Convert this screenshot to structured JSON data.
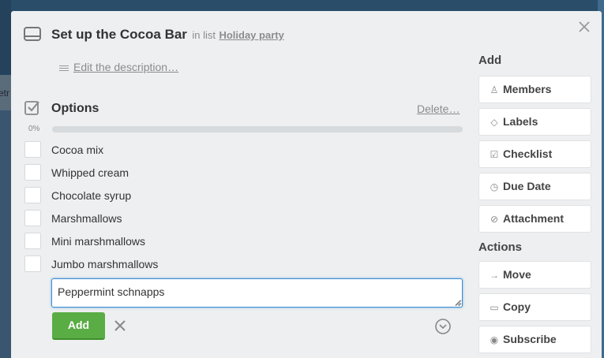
{
  "card": {
    "title": "Set up the Cocoa Bar",
    "in_list_prefix": "in list",
    "list_name": "Holiday party",
    "edit_description": "Edit the description…"
  },
  "checklist": {
    "title": "Options",
    "delete_label": "Delete…",
    "progress_label": "0%",
    "progress_percent": 0,
    "items": [
      {
        "label": "Cocoa mix",
        "checked": false
      },
      {
        "label": "Whipped cream",
        "checked": false
      },
      {
        "label": "Chocolate syrup",
        "checked": false
      },
      {
        "label": "Marshmallows",
        "checked": false
      },
      {
        "label": "Mini marshmallows",
        "checked": false
      },
      {
        "label": "Jumbo marshmallows",
        "checked": false
      }
    ],
    "new_item_value": "Peppermint schnapps",
    "add_label": "Add"
  },
  "sidebar": {
    "add_heading": "Add",
    "members": "Members",
    "labels": "Labels",
    "checklist": "Checklist",
    "due_date": "Due Date",
    "attachment": "Attachment",
    "actions_heading": "Actions",
    "move": "Move",
    "copy": "Copy",
    "subscribe": "Subscribe"
  },
  "backdrop": {
    "peek_text": "etr"
  },
  "colors": {
    "accent_green": "#5aac44",
    "focus_blue": "#3a8cd0",
    "modal_bg": "#edeff0"
  }
}
